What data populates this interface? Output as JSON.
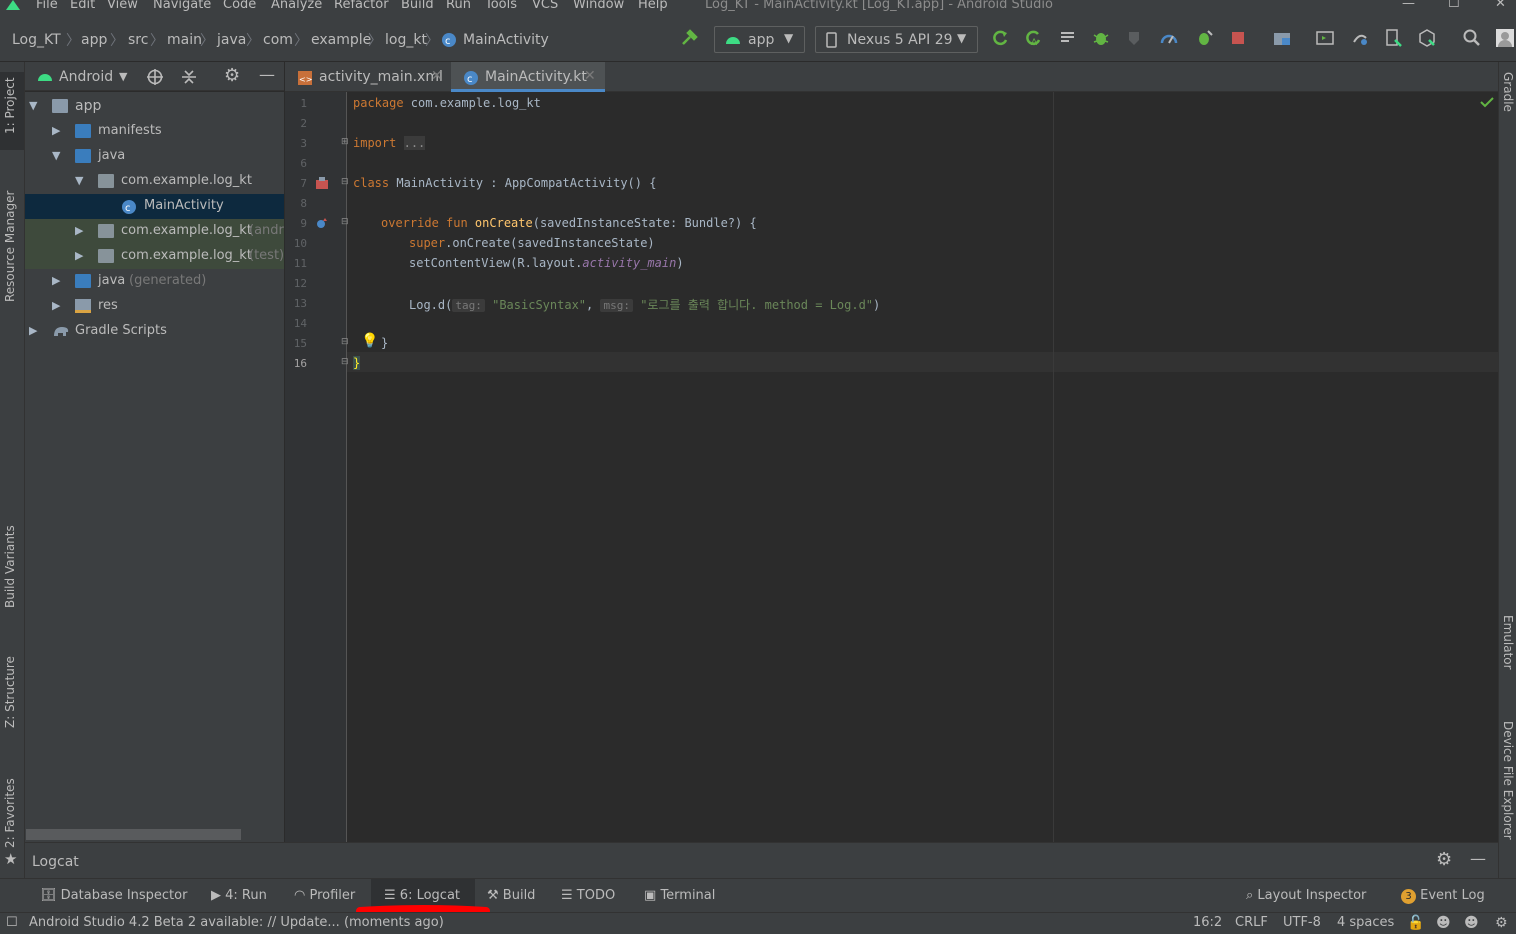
{
  "menu": {
    "items": [
      "File",
      "Edit",
      "View",
      "Navigate",
      "Code",
      "Analyze",
      "Refactor",
      "Build",
      "Run",
      "Tools",
      "VCS",
      "Window",
      "Help"
    ],
    "window_title": "Log_KT - MainActivity.kt [Log_KT.app] - Android Studio"
  },
  "breadcrumbs": [
    "Log_KT",
    "app",
    "src",
    "main",
    "java",
    "com",
    "example",
    "log_kt",
    "MainActivity"
  ],
  "toolbar": {
    "run_config": "app",
    "device": "Nexus 5 API 29"
  },
  "project_panel": {
    "view_mode": "Android",
    "tree": [
      {
        "label": "app",
        "suffix": ""
      },
      {
        "label": "manifests",
        "suffix": ""
      },
      {
        "label": "java",
        "suffix": ""
      },
      {
        "label": "com.example.log_kt",
        "suffix": ""
      },
      {
        "label": "MainActivity",
        "suffix": ""
      },
      {
        "label": "com.example.log_kt",
        "suffix": "(andr"
      },
      {
        "label": "com.example.log_kt",
        "suffix": "(test)"
      },
      {
        "label": "java",
        "suffix": "(generated)"
      },
      {
        "label": "res",
        "suffix": ""
      },
      {
        "label": "Gradle Scripts",
        "suffix": ""
      }
    ]
  },
  "side_tabs": {
    "left": [
      "1: Project",
      "Resource Manager",
      "Build Variants",
      "Z: Structure",
      "2: Favorites"
    ],
    "right": [
      "Gradle",
      "Emulator",
      "Device File Explorer"
    ]
  },
  "editor": {
    "tabs": [
      "activity_main.xml",
      "MainActivity.kt"
    ],
    "active_tab": "MainActivity.kt",
    "line_numbers": [
      "1",
      "2",
      "3",
      "6",
      "7",
      "8",
      "9",
      "10",
      "11",
      "12",
      "13",
      "14",
      "15",
      "16"
    ],
    "code": {
      "l1_kw": "package",
      "l1_rest": " com.example.log_kt",
      "l3_kw": "import",
      "l3_fold": "...",
      "l7_kw": "class",
      "l7_rest": " MainActivity : AppCompatActivity() {",
      "l9_kw": "override fun",
      "l9_fn": " onCreate",
      "l9_rest": "(savedInstanceState: Bundle?) {",
      "l10_kw": "super",
      "l10_rest": ".onCreate(savedInstanceState)",
      "l11_a": "setContentView(R.layout.",
      "l11_it": "activity_main",
      "l11_b": ")",
      "l13_a": "Log.d(",
      "l13_hint1": "tag:",
      "l13_s1": "\"BasicSyntax\"",
      "l13_c": ", ",
      "l13_hint2": "msg:",
      "l13_s2": "\"로그를 출력 합니다. method = Log.d\"",
      "l13_b": ")",
      "l15": "}",
      "l16": "}"
    }
  },
  "logcat_panel": {
    "title": "Logcat"
  },
  "tool_windows": {
    "left": [
      "Database Inspector",
      "4: Run",
      "Profiler",
      "6: Logcat",
      "Build",
      "TODO",
      "Terminal"
    ],
    "right": [
      "Layout Inspector",
      "Event Log"
    ],
    "event_log_count": "3"
  },
  "status": {
    "message": "Android Studio 4.2 Beta 2 available: // Update... (moments ago)",
    "position": "16:2",
    "line_sep": "CRLF",
    "encoding": "UTF-8",
    "indent": "4 spaces"
  },
  "colors": {
    "accent": "#4a88c7",
    "annotation": "#ff0000",
    "selection": "#0d293e"
  }
}
